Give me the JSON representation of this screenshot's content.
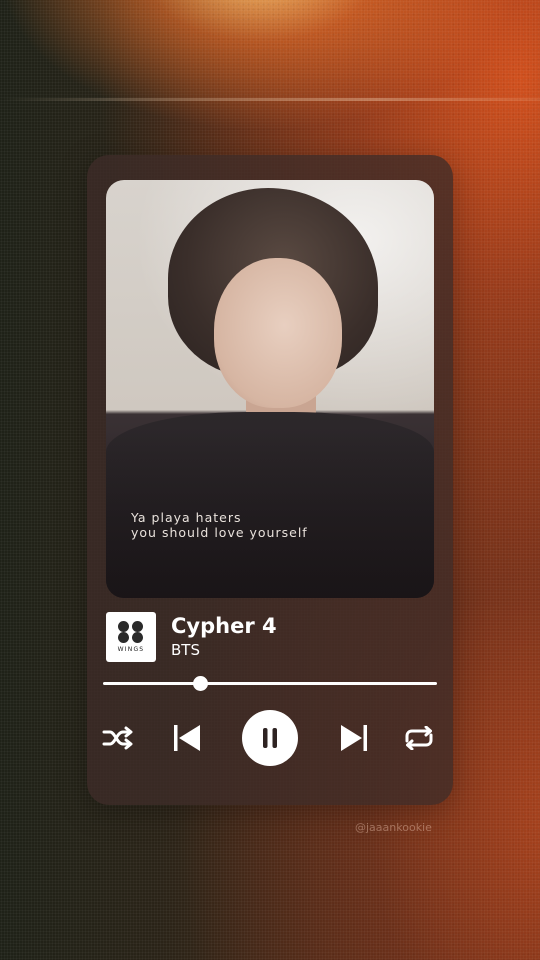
{
  "player": {
    "lyrics": [
      "Ya playa haters",
      "you should love yourself"
    ],
    "album_art_text": "WINGS",
    "track_title": "Cypher 4",
    "artist": "BTS",
    "progress": 0.29,
    "state": "playing",
    "controls": {
      "shuffle": "shuffle-icon",
      "previous": "skip-previous-icon",
      "play_pause": "pause-icon",
      "next": "skip-next-icon",
      "repeat": "repeat-icon"
    }
  },
  "watermark": "@jaaankookie",
  "colors": {
    "card_bg": "#3e2c28",
    "accent": "#ffffff",
    "background_warm": "#d6521e",
    "background_dark": "#1f2218"
  }
}
